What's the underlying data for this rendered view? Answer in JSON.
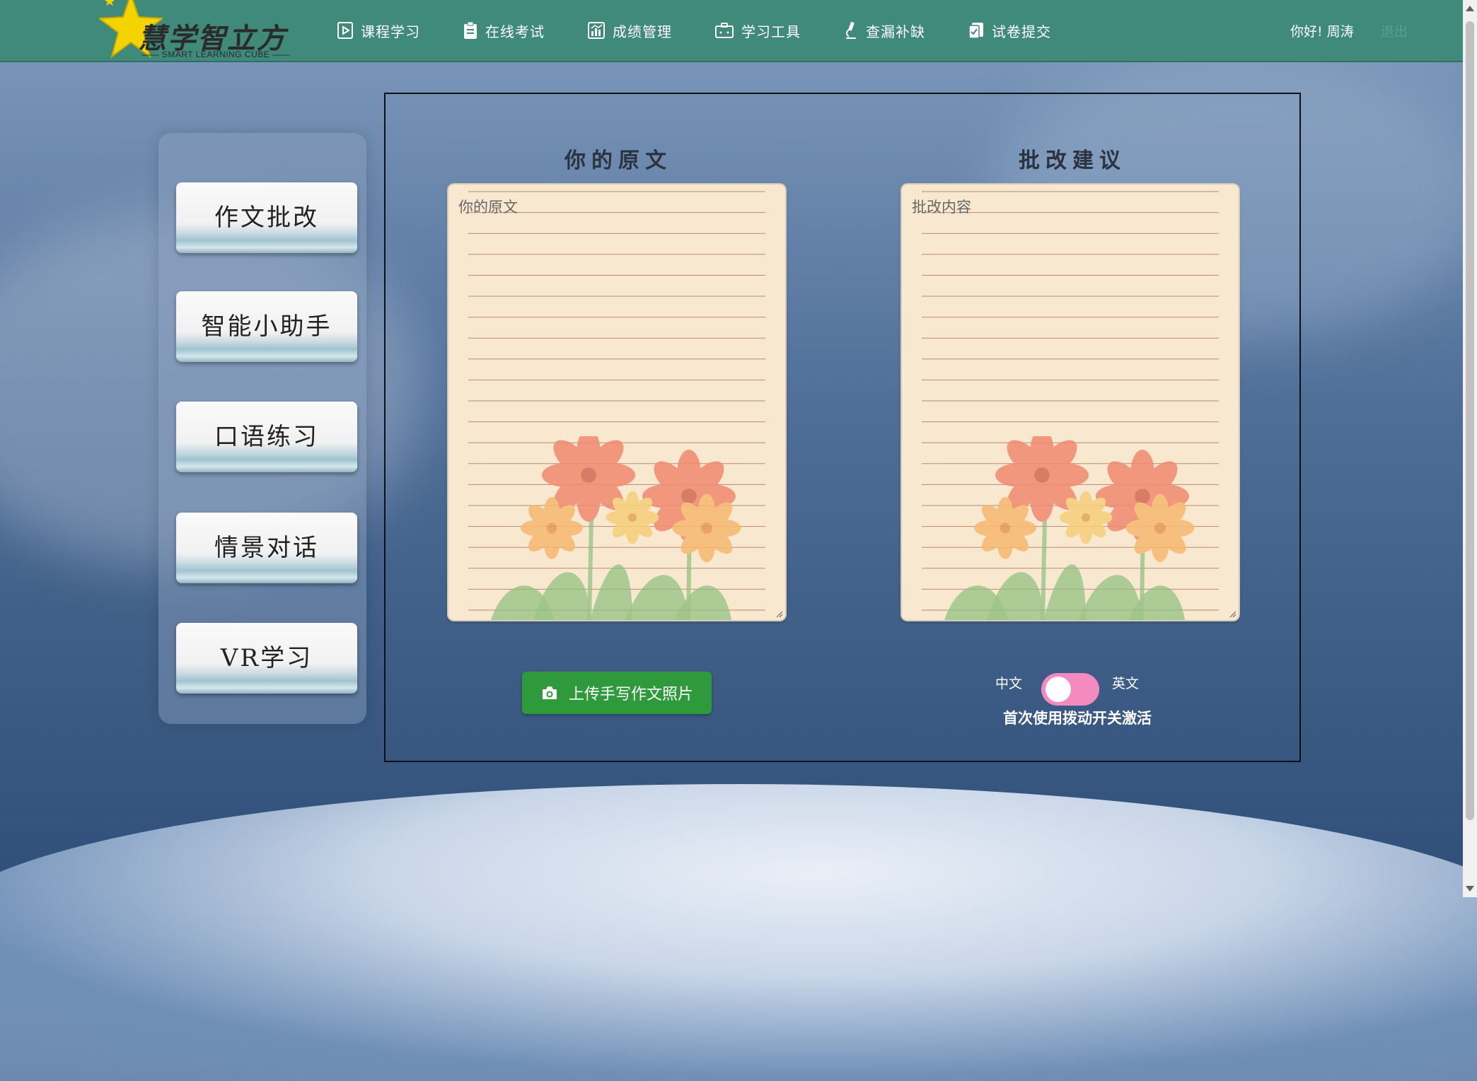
{
  "app": {
    "logo_text": "慧学智立方",
    "logo_sub": "—— SMART LEARNING CUBE ——"
  },
  "nav": {
    "items": [
      {
        "label": "课程学习",
        "icon": "play-doc-icon"
      },
      {
        "label": "在线考试",
        "icon": "clipboard-icon"
      },
      {
        "label": "成绩管理",
        "icon": "chart-icon"
      },
      {
        "label": "学习工具",
        "icon": "toolbox-icon"
      },
      {
        "label": "查漏补缺",
        "icon": "microscope-icon"
      },
      {
        "label": "试卷提交",
        "icon": "submit-doc-icon"
      }
    ],
    "greeting": "你好! 周涛",
    "logout": "退出"
  },
  "sidebar": {
    "items": [
      {
        "label": "作文批改"
      },
      {
        "label": "智能小助手"
      },
      {
        "label": "口语练习"
      },
      {
        "label": "情景对话"
      },
      {
        "label": "VR学习"
      }
    ]
  },
  "main": {
    "original": {
      "title": "你的原文",
      "placeholder": "你的原文"
    },
    "suggestion": {
      "title": "批改建议",
      "placeholder": "批改内容"
    },
    "upload_label": "上传手写作文照片",
    "toggle": {
      "left_label": "中文",
      "right_label": "英文",
      "hint": "首次使用拨动开关激活"
    }
  },
  "colors": {
    "topbar": "#3f8a7a",
    "upload_button": "#2e9a3c",
    "toggle": "#f48bc0",
    "paper": "#f9e8d0"
  }
}
